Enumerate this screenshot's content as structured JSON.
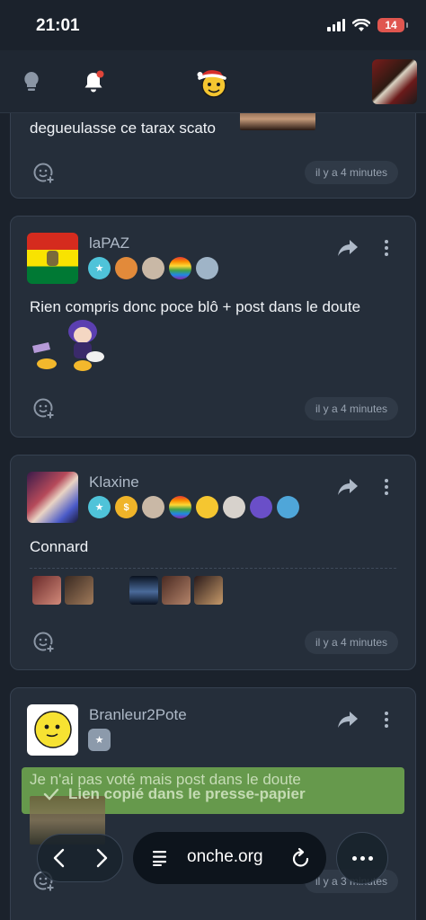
{
  "status_bar": {
    "time": "21:01",
    "battery": "14"
  },
  "header": {
    "icons": [
      "bulb-icon",
      "bell-icon",
      "santa-smiley-logo",
      "user-avatar"
    ]
  },
  "posts": [
    {
      "text": "degueulasse ce tarax scato",
      "time": "il y a 4 minutes"
    },
    {
      "username": "laPAZ",
      "text": "Rien compris donc poce blô + post dans le doute",
      "time": "il y a 4 minutes"
    },
    {
      "username": "Klaxine",
      "text": "Connard",
      "time": "il y a 4 minutes"
    },
    {
      "username": "Branleur2Pote",
      "text": "Je n'ai pas voté mais post dans le doute",
      "time": "il y a 3 minutes"
    }
  ],
  "toast": {
    "message": "Lien copié dans le presse-papier"
  },
  "browser": {
    "url": "onche.org"
  },
  "colors": {
    "background": "#1b222c",
    "card": "#252e3a",
    "toast": "#6fa84e",
    "notification_dot": "#e0453a"
  }
}
